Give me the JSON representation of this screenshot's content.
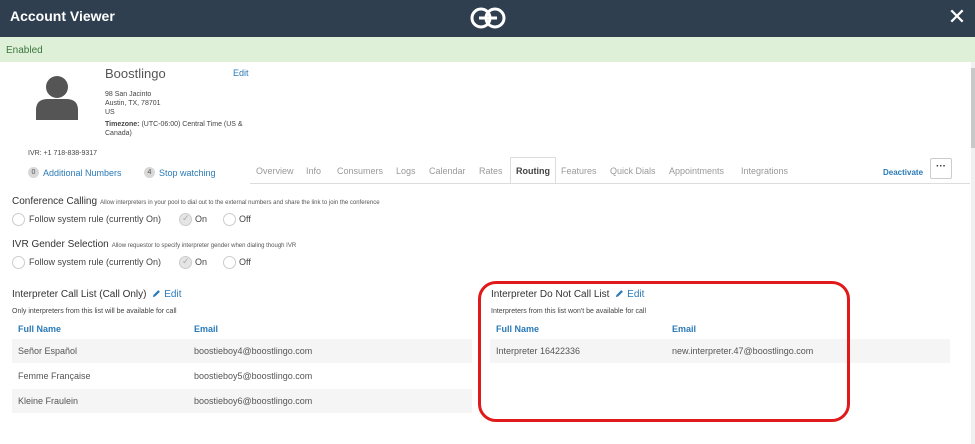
{
  "window": {
    "title": "Account Viewer",
    "logo_icon": "boostlingo-logo-icon",
    "close_icon": "close-icon"
  },
  "status": {
    "text": "Enabled",
    "color": "#dff0d8"
  },
  "account": {
    "name": "Boostlingo",
    "edit_label": "Edit",
    "address_line1": "98 San Jacinto",
    "address_line2": "Austin, TX, 78701",
    "address_line3": "US",
    "timezone_label": "Timezone:",
    "timezone_value": "(UTC-06:00) Central Time (US &",
    "timezone_cont": "Canada)",
    "ivr": "IVR: +1 718-838-9317",
    "additional_numbers": {
      "count": "0",
      "label": "Additional Numbers"
    },
    "stop_watching": {
      "count": "4",
      "label": "Stop watching"
    }
  },
  "tabs": [
    {
      "label": "Overview",
      "active": false
    },
    {
      "label": "Info",
      "active": false
    },
    {
      "label": "Consumers",
      "active": false
    },
    {
      "label": "Logs",
      "active": false
    },
    {
      "label": "Calendar",
      "active": false
    },
    {
      "label": "Rates",
      "active": false
    },
    {
      "label": "Routing",
      "active": true
    },
    {
      "label": "Features",
      "active": false
    },
    {
      "label": "Quick Dials",
      "active": false
    },
    {
      "label": "Appointments",
      "active": false
    },
    {
      "label": "Integrations",
      "active": false
    }
  ],
  "actions": {
    "deactivate": "Deactivate",
    "more": "···"
  },
  "conference_calling": {
    "title": "Conference Calling",
    "description": "Allow interpreters in your pool to dial out to the external numbers and share the link to join the conference",
    "options": [
      {
        "label": "Follow system rule (currently On)",
        "checked": false
      },
      {
        "label": "On",
        "checked": true
      },
      {
        "label": "Off",
        "checked": false
      }
    ]
  },
  "ivr_gender": {
    "title": "IVR Gender Selection",
    "description": "Allow requestor to specify interpreter gender when dialing though IVR",
    "options": [
      {
        "label": "Follow system rule (currently On)",
        "checked": false
      },
      {
        "label": "On",
        "checked": true
      },
      {
        "label": "Off",
        "checked": false
      }
    ]
  },
  "call_list": {
    "title": "Interpreter Call List (Call Only)",
    "edit_label": "Edit",
    "description": "Only interpreters from this list will be available for call",
    "columns": [
      "Full Name",
      "Email"
    ],
    "rows": [
      {
        "name": "Señor Español",
        "email": "boostieboy4@boostlingo.com"
      },
      {
        "name": "Femme Française",
        "email": "boostieboy5@boostlingo.com"
      },
      {
        "name": "Kleine Fraulein",
        "email": "boostieboy6@boostlingo.com"
      }
    ]
  },
  "do_not_call_list": {
    "title": "Interpreter Do Not Call List",
    "edit_label": "Edit",
    "description": "Interpreters from this list won't be available for call",
    "columns": [
      "Full Name",
      "Email"
    ],
    "rows": [
      {
        "name": "Interpreter 16422336",
        "email": "new.interpreter.47@boostlingo.com"
      }
    ]
  },
  "colors": {
    "topbar": "#2f3f50",
    "link": "#2a7ab8",
    "highlight": "#e01a1a"
  }
}
